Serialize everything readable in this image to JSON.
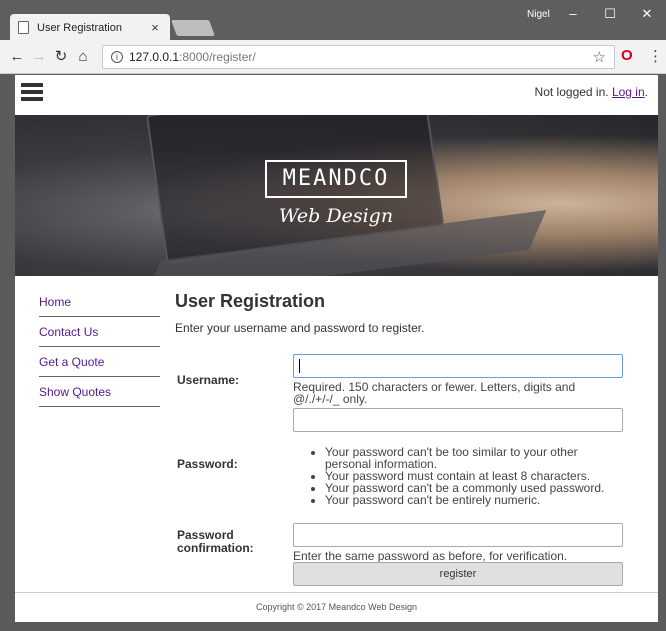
{
  "browser": {
    "tab_title": "User Registration",
    "tab_close": "×",
    "user_name": "Nigel",
    "window_controls": {
      "minimize": "–",
      "maximize": "☐",
      "close": "✕"
    },
    "url_host": "127.0.0.1",
    "url_rest": ":8000/register/"
  },
  "header": {
    "login_status": "Not logged in.",
    "login_link": "Log in",
    "login_period": "."
  },
  "hero": {
    "logo_text": "MEANDCO",
    "logo_subtitle": "Web Design"
  },
  "sidebar": {
    "items": [
      {
        "label": "Home"
      },
      {
        "label": "Contact Us"
      },
      {
        "label": "Get a Quote"
      },
      {
        "label": "Show Quotes"
      }
    ]
  },
  "main": {
    "title": "User Registration",
    "intro": "Enter your username and password to register.",
    "username": {
      "label": "Username:",
      "value": "",
      "help": "Required. 150 characters or fewer. Letters, digits and @/./+/-/_ only."
    },
    "password": {
      "label": "Password:",
      "value": "",
      "help_items": [
        "Your password can't be too similar to your other personal information.",
        "Your password must contain at least 8 characters.",
        "Your password can't be a commonly used password.",
        "Your password can't be entirely numeric."
      ]
    },
    "password_confirmation": {
      "label_line1": "Password",
      "label_line2": "confirmation:",
      "value": "",
      "help": "Enter the same password as before, for verification."
    },
    "submit_label": "register"
  },
  "footer": {
    "copyright": "Copyright © 2017 Meandco Web Design"
  }
}
